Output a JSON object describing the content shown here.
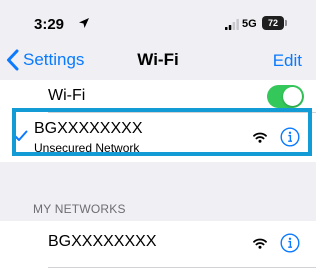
{
  "status_bar": {
    "time": "3:29",
    "network_type": "5G",
    "battery_level": "72"
  },
  "nav": {
    "back_label": "Settings",
    "title": "Wi-Fi",
    "edit_label": "Edit"
  },
  "wifi_toggle": {
    "label": "Wi-Fi",
    "on": true
  },
  "current_network": {
    "name": "BGXXXXXXXX",
    "status": "Unsecured Network"
  },
  "my_networks": {
    "header": "MY NETWORKS",
    "items": [
      {
        "name": "BGXXXXXXXX"
      }
    ]
  },
  "colors": {
    "accent": "#0a7aff",
    "toggle_on": "#34c759",
    "highlight": "#139bd6",
    "background": "#efeff4"
  }
}
